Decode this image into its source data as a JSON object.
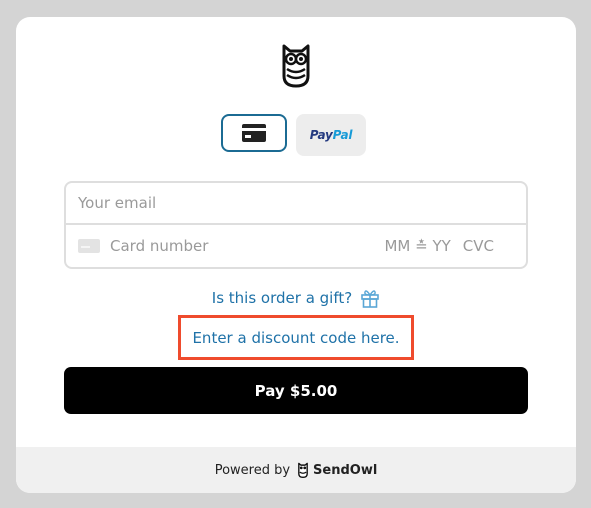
{
  "payment_methods": {
    "card_icon": "credit-card-icon",
    "paypal": {
      "part1": "Pay",
      "part2": "Pal"
    }
  },
  "form": {
    "email_placeholder": "Your email",
    "card_number_placeholder": "Card number",
    "expiry_placeholder": "MM ≛ YY",
    "cvc_placeholder": "CVC"
  },
  "links": {
    "gift": "Is this order a gift?",
    "discount": "Enter a discount code here."
  },
  "pay_button": "Pay $5.00",
  "footer": {
    "powered_by": "Powered by",
    "brand": "SendOwl"
  },
  "colors": {
    "accent": "#1f72a8",
    "highlight": "#ef4b2d",
    "button": "#000000",
    "selected_border": "#1b6b93"
  }
}
